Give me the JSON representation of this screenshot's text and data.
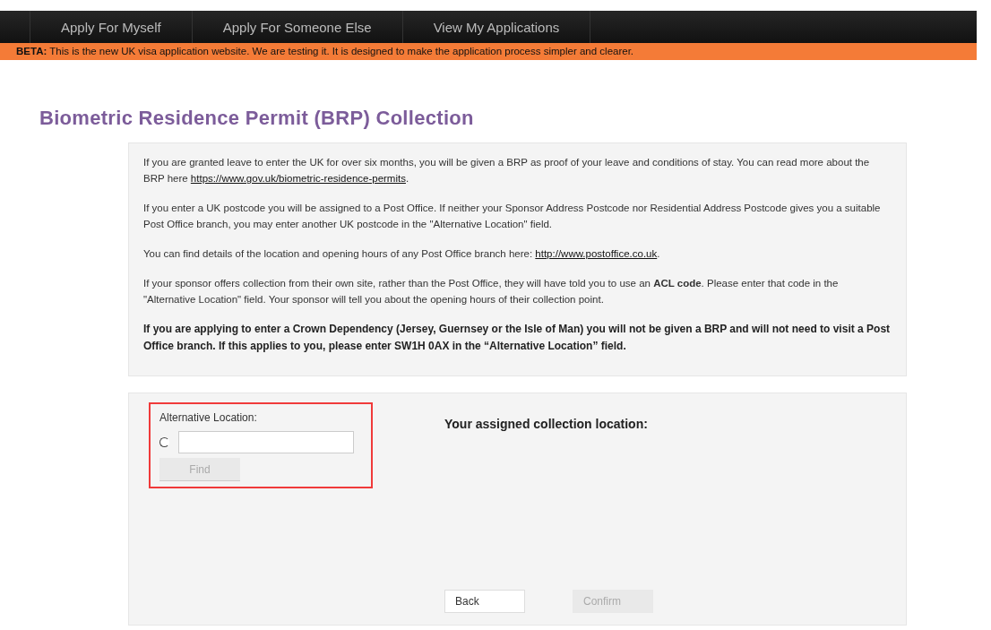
{
  "nav": {
    "items": [
      {
        "label": "Apply For Myself"
      },
      {
        "label": "Apply For Someone Else"
      },
      {
        "label": "View My Applications"
      }
    ]
  },
  "beta_banner": {
    "text": "**BETA:** This is the new UK visa application website. We are testing it. It is designed to make the application process simpler and clearer."
  },
  "page_title": "Biometric Residence Permit (BRP) Collection",
  "info_paragraphs": [
    {
      "bold": false,
      "parts": [
        {
          "kind": "text",
          "text": "If you are granted leave to enter the UK for over six months, you will be given a BRP as proof of your leave and conditions of stay.  You can read more about the BRP here "
        },
        {
          "kind": "link",
          "text": "https://www.gov.uk/biometric-residence-permits"
        },
        {
          "kind": "text",
          "text": "."
        }
      ]
    },
    {
      "bold": false,
      "parts": [
        {
          "kind": "text",
          "text": "If you enter a UK postcode you will be assigned to a Post Office.  If neither your Sponsor Address Postcode nor Residential Address Postcode gives you a suitable Post Office branch, you may enter another UK postcode in the \"Alternative Location\" field."
        }
      ]
    },
    {
      "bold": false,
      "parts": [
        {
          "kind": "text",
          "text": "You can find details of the location and opening hours of any Post Office branch here: "
        },
        {
          "kind": "link",
          "text": "http://www.postoffice.co.uk"
        },
        {
          "kind": "text",
          "text": "."
        }
      ]
    },
    {
      "bold": false,
      "parts": [
        {
          "kind": "text",
          "text": "If your sponsor offers collection from their own site, rather than the Post Office, they will have told you to use an **ACL code**.  Please enter that code in the \"Alternative Location\" field.  Your sponsor will tell you about the opening hours of their collection point."
        }
      ]
    },
    {
      "bold": true,
      "parts": [
        {
          "kind": "text",
          "text": "If you are applying to enter a Crown Dependency (Jersey, Guernsey or the Isle of Man) you will not be given a BRP and will not need to visit a Post Office branch. If this applies to you, please enter SW1H 0AX in the “Alternative Location” field."
        }
      ]
    }
  ],
  "alternative_location": {
    "label": "Alternative Location:",
    "radio_checked": false,
    "find_button": {
      "label": "Find",
      "disabled": true
    }
  },
  "assigned_heading": "Your assigned collection location:",
  "buttons": [
    {
      "label": "Back",
      "disabled": false
    },
    {
      "label": "Confirm",
      "disabled": true
    }
  ]
}
